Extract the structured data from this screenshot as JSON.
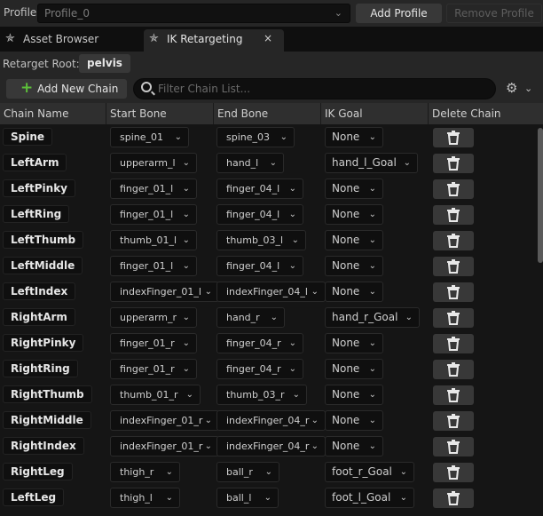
{
  "profile": {
    "label": "Profile",
    "value": "Profile_0",
    "add_label": "Add Profile",
    "remove_label": "Remove Profile"
  },
  "tabs": [
    {
      "label": "Asset Browser",
      "icon": "running-figure-icon"
    },
    {
      "label": "IK Retargeting",
      "icon": "running-figure-icon",
      "close": "×"
    }
  ],
  "retarget_root": {
    "label": "Retarget Root:",
    "value": "pelvis"
  },
  "toolbar": {
    "add_chain_label": "Add New Chain",
    "filter_placeholder": "Filter Chain List..."
  },
  "columns": [
    "Chain Name",
    "Start Bone",
    "End Bone",
    "IK Goal",
    "Delete Chain"
  ],
  "chains": [
    {
      "name": "Spine",
      "start": "spine_01",
      "end": "spine_03",
      "goal": "None"
    },
    {
      "name": "LeftArm",
      "start": "upperarm_l",
      "end": "hand_l",
      "goal": "hand_l_Goal"
    },
    {
      "name": "LeftPinky",
      "start": "finger_01_l",
      "end": "finger_04_l",
      "goal": "None"
    },
    {
      "name": "LeftRing",
      "start": "finger_01_l",
      "end": "finger_04_l",
      "goal": "None"
    },
    {
      "name": "LeftThumb",
      "start": "thumb_01_l",
      "end": "thumb_03_l",
      "goal": "None"
    },
    {
      "name": "LeftMiddle",
      "start": "finger_01_l",
      "end": "finger_04_l",
      "goal": "None"
    },
    {
      "name": "LeftIndex",
      "start": "indexFinger_01_l",
      "end": "indexFinger_04_l",
      "goal": "None"
    },
    {
      "name": "RightArm",
      "start": "upperarm_r",
      "end": "hand_r",
      "goal": "hand_r_Goal"
    },
    {
      "name": "RightPinky",
      "start": "finger_01_r",
      "end": "finger_04_r",
      "goal": "None"
    },
    {
      "name": "RightRing",
      "start": "finger_01_r",
      "end": "finger_04_r",
      "goal": "None"
    },
    {
      "name": "RightThumb",
      "start": "thumb_01_r",
      "end": "thumb_03_r",
      "goal": "None"
    },
    {
      "name": "RightMiddle",
      "start": "indexFinger_01_r",
      "end": "indexFinger_04_r",
      "goal": "None"
    },
    {
      "name": "RightIndex",
      "start": "indexFinger_01_r",
      "end": "indexFinger_04_r",
      "goal": "None"
    },
    {
      "name": "RightLeg",
      "start": "thigh_r",
      "end": "ball_r",
      "goal": "foot_r_Goal"
    },
    {
      "name": "LeftLeg",
      "start": "thigh_l",
      "end": "ball_l",
      "goal": "foot_l_Goal"
    }
  ],
  "colors": {
    "accent_green": "#5cbf3a",
    "panel": "#262626",
    "background": "#151515"
  }
}
